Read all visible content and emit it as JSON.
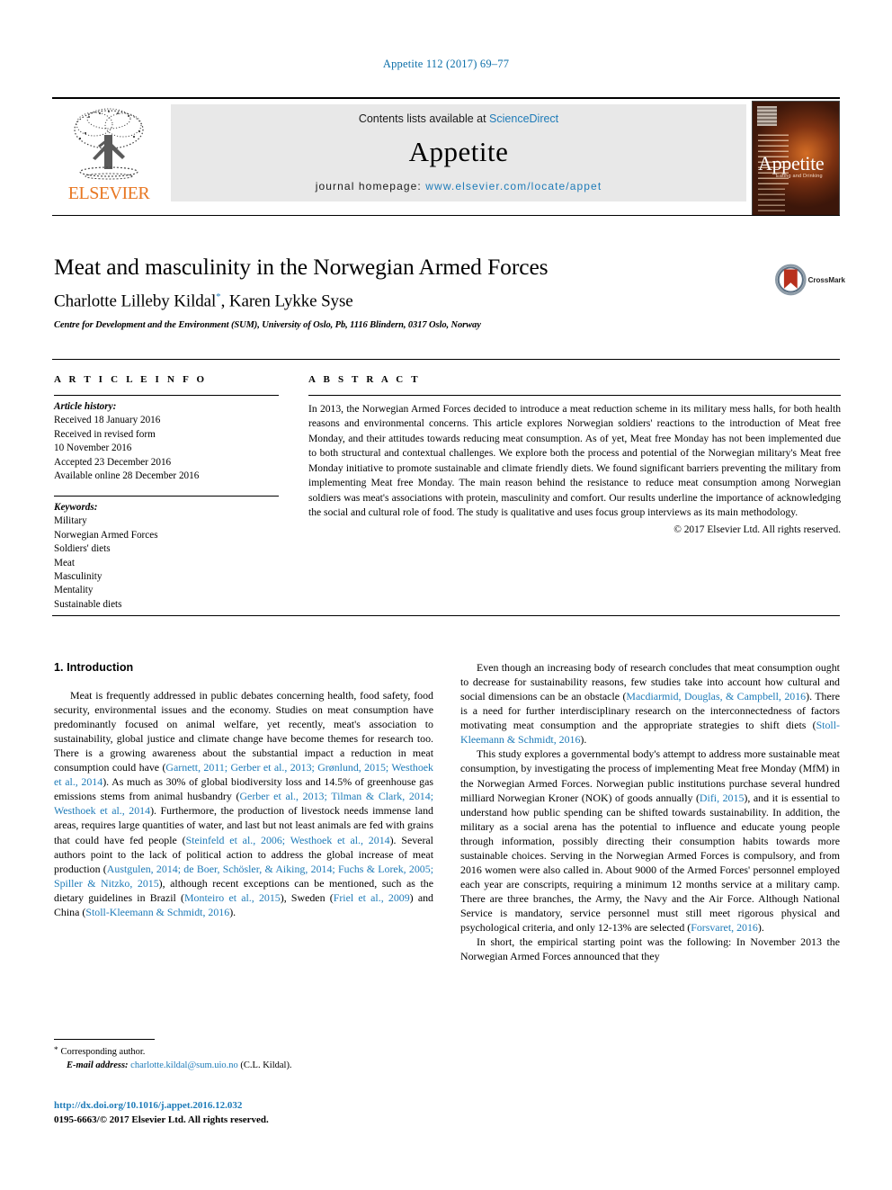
{
  "running_head": "Appetite 112 (2017) 69–77",
  "masthead": {
    "publisher_name": "ELSEVIER",
    "publisher_logo_icon": "elsevier-tree-icon",
    "contents_prefix": "Contents lists available at ",
    "contents_link": "ScienceDirect",
    "journal_title": "Appetite",
    "homepage_prefix": "journal homepage: ",
    "homepage_url": "www.elsevier.com/locate/appet",
    "cover": {
      "title": "Appetite",
      "subtitle": "Eating and Drinking"
    }
  },
  "article": {
    "title": "Meat and masculinity in the Norwegian Armed Forces",
    "authors": "Charlotte Lilleby Kildal",
    "author_marker": "*",
    "authors_rest": ", Karen Lykke Syse",
    "affiliation": "Centre for Development and the Environment (SUM), University of Oslo, Pb, 1116 Blindern, 0317 Oslo, Norway",
    "crossmark_label": "CrossMark"
  },
  "article_info": {
    "heading": "A R T I C L E   I N F O",
    "history_label": "Article history:",
    "history": [
      "Received 18 January 2016",
      "Received in revised form",
      "10 November 2016",
      "Accepted 23 December 2016",
      "Available online 28 December 2016"
    ],
    "keywords_label": "Keywords:",
    "keywords": [
      "Military",
      "Norwegian Armed Forces",
      "Soldiers' diets",
      "Meat",
      "Masculinity",
      "Mentality",
      "Sustainable diets"
    ]
  },
  "abstract": {
    "heading": "A B S T R A C T",
    "text": "In 2013, the Norwegian Armed Forces decided to introduce a meat reduction scheme in its military mess halls, for both health reasons and environmental concerns. This article explores Norwegian soldiers' reactions to the introduction of Meat free Monday, and their attitudes towards reducing meat consumption. As of yet, Meat free Monday has not been implemented due to both structural and contextual challenges. We explore both the process and potential of the Norwegian military's Meat free Monday initiative to promote sustainable and climate friendly diets. We found significant barriers preventing the military from implementing Meat free Monday. The main reason behind the resistance to reduce meat consumption among Norwegian soldiers was meat's associations with protein, masculinity and comfort. Our results underline the importance of acknowledging the social and cultural role of food. The study is qualitative and uses focus group interviews as its main methodology.",
    "copyright": "© 2017 Elsevier Ltd. All rights reserved."
  },
  "body": {
    "left": {
      "section_number_title": "1.  Introduction",
      "paragraph_1_a": "Meat is frequently addressed in public debates concerning health, food safety, food security, environmental issues and the economy. Studies on meat consumption have predominantly focused on animal welfare, yet recently, meat's association to sustainability, global justice and climate change have become themes for research too. There is a growing awareness about the substantial impact a reduction in meat consumption could have (",
      "ref_1": "Garnett, 2011; Gerber et al., 2013; Grønlund, 2015; Westhoek et al., 2014",
      "paragraph_1_b": "). As much as 30% of global biodiversity loss and 14.5% of greenhouse gas emissions stems from animal husbandry (",
      "ref_2": "Gerber et al., 2013; Tilman & Clark, 2014; Westhoek et al., 2014",
      "paragraph_1_c": "). Furthermore, the production of livestock needs immense land areas, requires large quantities of water, and last but not least animals are fed with grains that could have fed people (",
      "ref_3": "Steinfeld et al., 2006; Westhoek et al., 2014",
      "paragraph_1_d": "). Several authors point to the lack of political action to address the global increase of meat production (",
      "ref_4": "Austgulen, 2014; de Boer, Schösler, & Aiking, 2014; Fuchs & Lorek, 2005; Spiller & Nitzko, 2015",
      "paragraph_1_e": "), although recent exceptions can be mentioned, such as the dietary guidelines in Brazil (",
      "ref_5": "Monteiro et al., 2015",
      "paragraph_1_f": "), Sweden (",
      "ref_6": "Friel et al., 2009",
      "paragraph_1_g": ") and China (",
      "ref_7": "Stoll-Kleemann & Schmidt, 2016",
      "paragraph_1_h": ")."
    },
    "right": {
      "paragraph_2_a": "Even though an increasing body of research concludes that meat consumption ought to decrease for sustainability reasons, few studies take into account how cultural and social dimensions can be an obstacle (",
      "ref_8": "Macdiarmid, Douglas, & Campbell, 2016",
      "paragraph_2_b": "). There is a need for further interdisciplinary research on the interconnectedness of factors motivating meat consumption and the appropriate strategies to shift diets (",
      "ref_9": "Stoll-Kleemann & Schmidt, 2016",
      "paragraph_2_c": ").",
      "paragraph_3_a": "This study explores a governmental body's attempt to address more sustainable meat consumption, by investigating the process of implementing Meat free Monday (MfM) in the Norwegian Armed Forces. Norwegian public institutions purchase several hundred milliard Norwegian Kroner (NOK) of goods annually (",
      "ref_10": "Difi, 2015",
      "paragraph_3_b": "), and it is essential to understand how public spending can be shifted towards sustainability. In addition, the military as a social arena has the potential to influence and educate young people through information, possibly directing their consumption habits towards more sustainable choices. Serving in the Norwegian Armed Forces is compulsory, and from 2016 women were also called in. About 9000 of the Armed Forces' personnel employed each year are conscripts, requiring a minimum 12 months service at a military camp. There are three branches, the Army, the Navy and the Air Force. Although National Service is mandatory, service personnel must still meet rigorous physical and psychological criteria, and only 12-13% are selected (",
      "ref_11": "Forsvaret, 2016",
      "paragraph_3_c": ").",
      "paragraph_4": "In short, the empirical starting point was the following: In November 2013 the Norwegian Armed Forces announced that they"
    }
  },
  "footnotes": {
    "corresponding_author": "Corresponding author.",
    "email_label": "E-mail address:",
    "email": "charlotte.kildal@sum.uio.no",
    "email_attribution": "(C.L. Kildal).",
    "doi": "http://dx.doi.org/10.1016/j.appet.2016.12.032",
    "issn_line": "0195-6663/© 2017 Elsevier Ltd. All rights reserved."
  },
  "colors": {
    "link_blue": "#1e7bb8",
    "elsevier_orange": "#e87722",
    "band_grey": "#e8e8e8"
  }
}
